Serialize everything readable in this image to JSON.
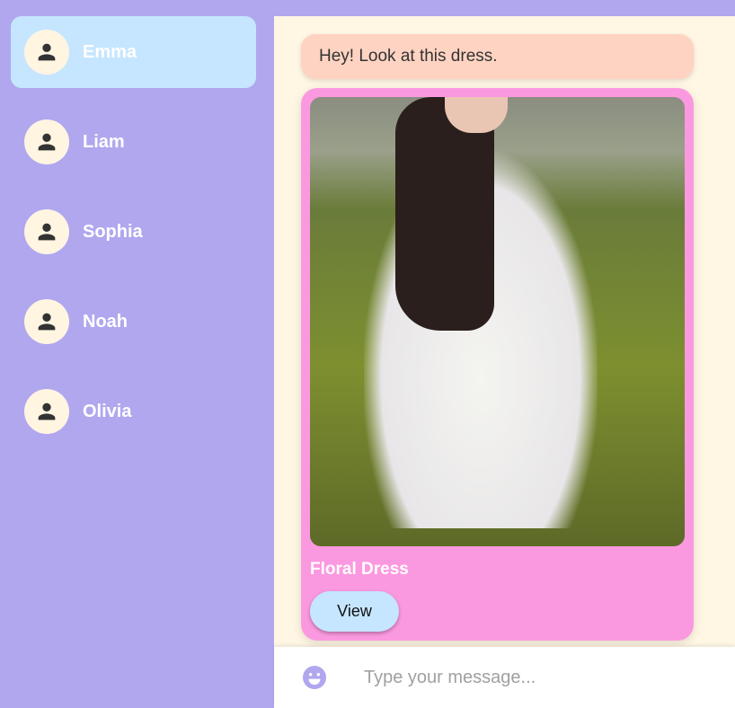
{
  "contacts": [
    {
      "name": "Emma",
      "active": true
    },
    {
      "name": "Liam"
    },
    {
      "name": "Sophia"
    },
    {
      "name": "Noah"
    },
    {
      "name": "Olivia"
    }
  ],
  "chat": {
    "message": "Hey! Look at this dress.",
    "product": {
      "title": "Floral Dress",
      "button": "View"
    }
  },
  "input": {
    "placeholder": "Type your message..."
  },
  "colors": {
    "sidebar": "#b0a7ef",
    "active": "#c6e6ff",
    "card": "#fb99e0",
    "bubble": "#ffd3c1"
  }
}
